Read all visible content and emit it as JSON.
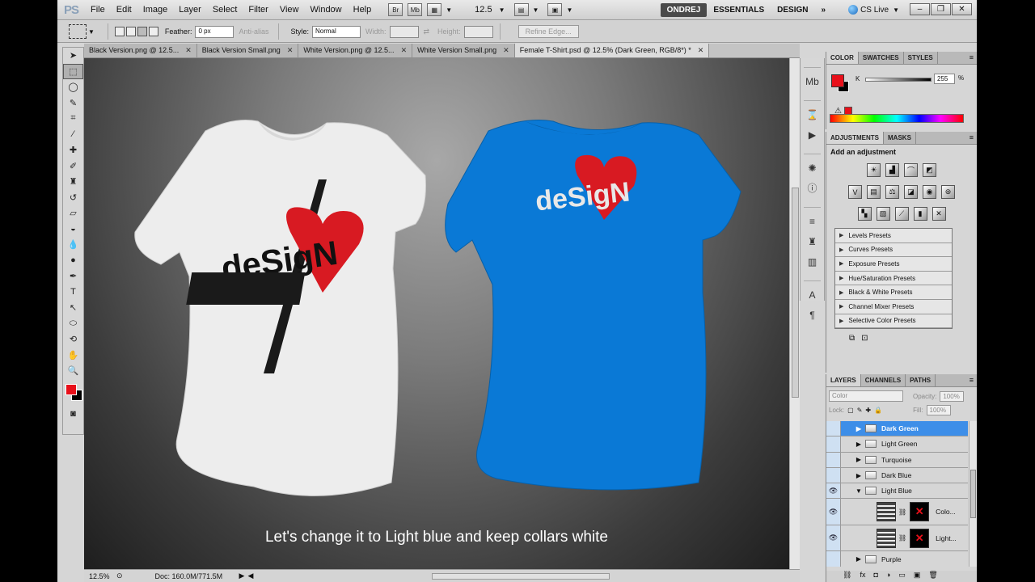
{
  "app": {
    "logo": "PS",
    "menu": [
      "File",
      "Edit",
      "Image",
      "Layer",
      "Select",
      "Filter",
      "View",
      "Window",
      "Help"
    ],
    "zoom": "12.5",
    "workspaces": [
      "ONDREJ",
      "ESSENTIALS",
      "DESIGN"
    ],
    "cs_live": "CS Live"
  },
  "options": {
    "feather_label": "Feather:",
    "feather_value": "0 px",
    "antialias_label": "Anti-alias",
    "style_label": "Style:",
    "style_value": "Normal",
    "width_label": "Width:",
    "height_label": "Height:",
    "refine_button": "Refine Edge..."
  },
  "tabs": [
    {
      "label": "Black Version.png @ 12.5...",
      "active": false
    },
    {
      "label": "Black Version Small.png",
      "active": false
    },
    {
      "label": "White Version.png @ 12.5...",
      "active": false
    },
    {
      "label": "White Version Small.png",
      "active": false
    },
    {
      "label": "Female T-Shirt.psd @ 12.5% (Dark Green, RGB/8*) *",
      "active": true
    }
  ],
  "canvas": {
    "caption": "Let's change it to Light blue and keep collars white",
    "shirt_left_color": "#f2f2f2",
    "shirt_right_color": "#0a79d6",
    "design_word": "deSigN"
  },
  "status": {
    "zoom": "12.5%",
    "doc": "Doc: 160.0M/771.5M"
  },
  "color_panel": {
    "tabs": [
      "COLOR",
      "SWATCHES",
      "STYLES"
    ],
    "channel": "K",
    "value": "255",
    "unit": "%",
    "fg_color": "#e8101a",
    "bg_color": "#000000"
  },
  "adjustments": {
    "tabs": [
      "ADJUSTMENTS",
      "MASKS"
    ],
    "title": "Add an adjustment",
    "presets": [
      "Levels Presets",
      "Curves Presets",
      "Exposure Presets",
      "Hue/Saturation Presets",
      "Black & White Presets",
      "Channel Mixer Presets",
      "Selective Color Presets"
    ]
  },
  "layers": {
    "tabs": [
      "LAYERS",
      "CHANNELS",
      "PATHS"
    ],
    "blend_mode": "Color",
    "opacity_label": "Opacity:",
    "opacity_value": "100%",
    "lock_label": "Lock:",
    "fill_label": "Fill:",
    "fill_value": "100%",
    "items": [
      {
        "name": "Dark Green",
        "kind": "folder",
        "selected": true,
        "visible": false,
        "open": false
      },
      {
        "name": "Light Green",
        "kind": "folder",
        "selected": false,
        "visible": false,
        "open": false
      },
      {
        "name": "Turquoise",
        "kind": "folder",
        "selected": false,
        "visible": false,
        "open": false
      },
      {
        "name": "Dark Blue",
        "kind": "folder",
        "selected": false,
        "visible": false,
        "open": false
      },
      {
        "name": "Light Blue",
        "kind": "folder",
        "selected": false,
        "visible": true,
        "open": true
      },
      {
        "name": "Colo...",
        "kind": "adjustment",
        "selected": false,
        "visible": true
      },
      {
        "name": "Light...",
        "kind": "adjustment",
        "selected": false,
        "visible": true
      },
      {
        "name": "Purple",
        "kind": "folder",
        "selected": false,
        "visible": false,
        "open": false
      }
    ]
  }
}
